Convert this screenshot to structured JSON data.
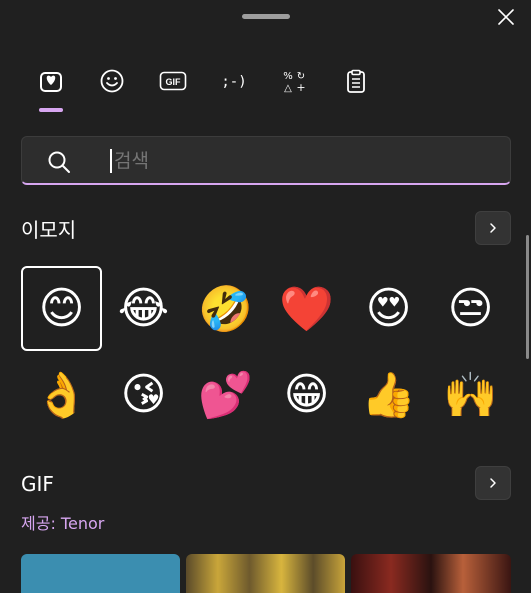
{
  "window": {
    "close_icon": "close-icon"
  },
  "tabs": [
    {
      "name": "tab-favorites",
      "icon": "heart-clipboard-icon",
      "active": true
    },
    {
      "name": "tab-emoji",
      "icon": "smiley-icon"
    },
    {
      "name": "tab-gif",
      "icon": "gif-icon",
      "label": "GIF"
    },
    {
      "name": "tab-kaomoji",
      "icon": "kaomoji-icon",
      "label": ";-)"
    },
    {
      "name": "tab-symbols",
      "icon": "symbols-icon"
    },
    {
      "name": "tab-clipboard",
      "icon": "clipboard-history-icon"
    }
  ],
  "search": {
    "placeholder": "검색",
    "value": ""
  },
  "emoji_section": {
    "title": "이모지",
    "emojis": [
      "😊",
      "😂",
      "🤣",
      "❤️",
      "😍",
      "😒",
      "👌",
      "😘",
      "💕",
      "😁",
      "👍",
      "🙌"
    ]
  },
  "gif_section": {
    "title": "GIF",
    "provider": "제공: Tenor"
  },
  "colors": {
    "accent": "#d7a6f0",
    "background": "#202020"
  }
}
